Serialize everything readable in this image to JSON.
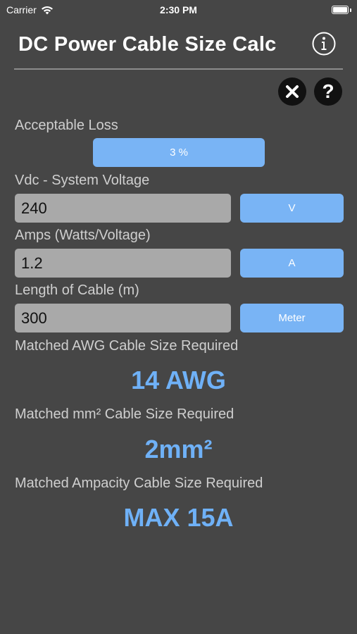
{
  "status_bar": {
    "carrier": "Carrier",
    "time": "2:30 PM"
  },
  "header": {
    "title": "DC Power Cable Size Calc",
    "info_icon": "info-circle-icon"
  },
  "toolbar": {
    "clear_icon": "close-icon",
    "help_icon": "help-icon",
    "help_glyph": "?"
  },
  "form": {
    "acceptable_loss": {
      "label": "Acceptable Loss",
      "value": "3 %"
    },
    "voltage": {
      "label": "Vdc - System Voltage",
      "value": "240",
      "unit": "V"
    },
    "amps": {
      "label": "Amps (Watts/Voltage)",
      "value": "1.2",
      "unit": "A"
    },
    "length": {
      "label": "Length of Cable (m)",
      "value": "300",
      "unit": "Meter"
    }
  },
  "results": {
    "awg": {
      "label": "Matched AWG Cable Size Required",
      "value": "14 AWG"
    },
    "mm2": {
      "label": "Matched mm² Cable Size Required",
      "value": "2mm²"
    },
    "ampacity": {
      "label": "Matched Ampacity Cable Size Required",
      "value": "MAX 15A"
    }
  },
  "colors": {
    "background": "#464646",
    "accent_button": "#79b4f5",
    "result_text": "#6fb1f7",
    "field_background": "#a9a9a9"
  }
}
